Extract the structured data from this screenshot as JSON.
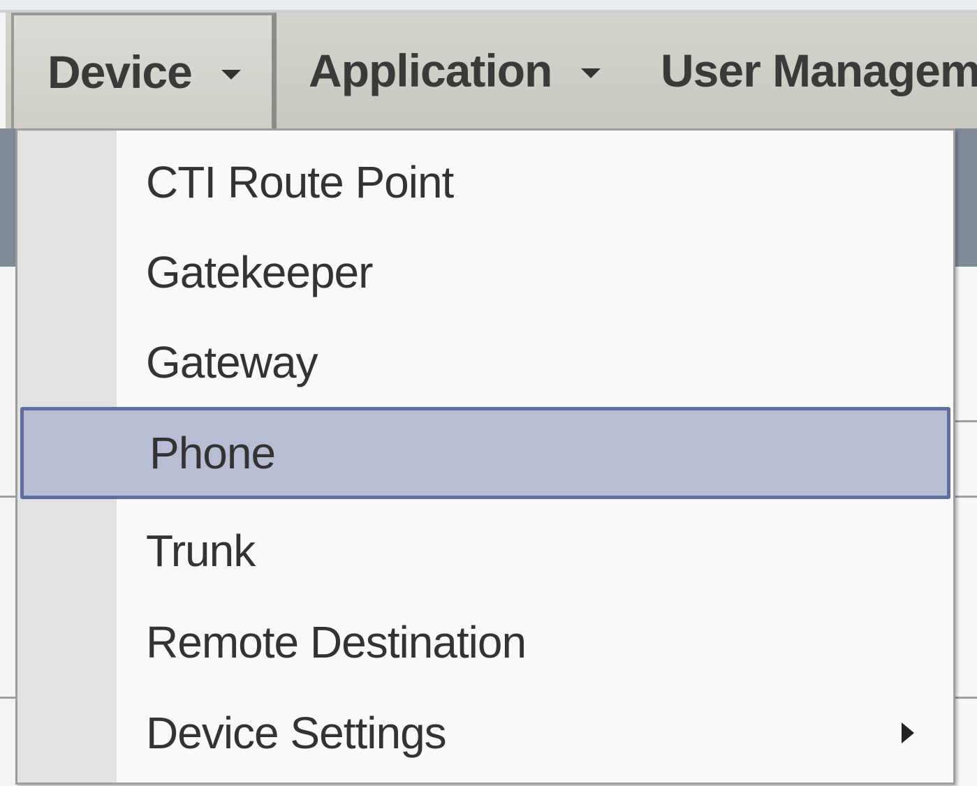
{
  "menubar": {
    "tabs": [
      {
        "label": "Device"
      },
      {
        "label": "Application"
      },
      {
        "label": "User Managem"
      }
    ]
  },
  "dropdown": {
    "items": [
      {
        "label": "CTI Route Point"
      },
      {
        "label": "Gatekeeper"
      },
      {
        "label": "Gateway"
      },
      {
        "label": "Phone",
        "selected": true
      },
      {
        "label": "Trunk"
      },
      {
        "label": "Remote Destination"
      },
      {
        "label": "Device Settings",
        "has_submenu": true
      }
    ]
  },
  "colors": {
    "menubar_bg": "#cfcfc8",
    "selected_bg": "#b7bdd5",
    "selected_border": "#5f6ea0",
    "text": "#333333"
  }
}
